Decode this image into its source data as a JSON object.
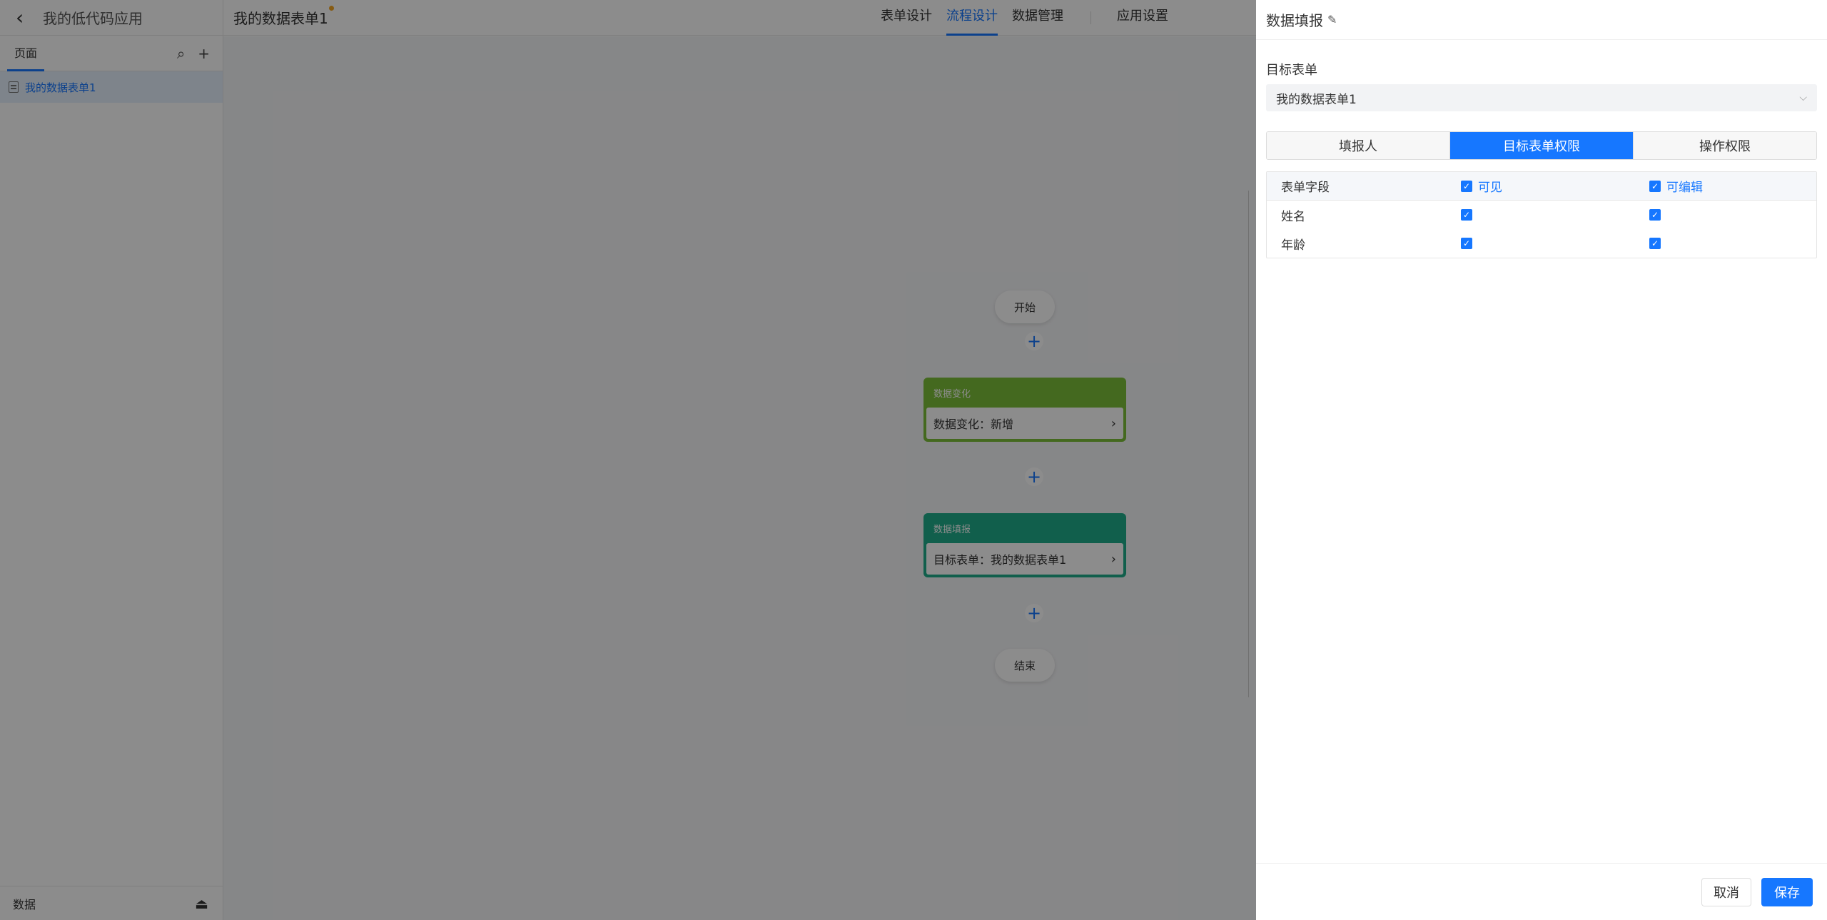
{
  "sidebar": {
    "back_icon": "chevron-left-icon",
    "app_title": "我的低代码应用",
    "tab_pages": "页面",
    "search_icon": "search-icon",
    "add_icon": "plus-icon",
    "items": [
      {
        "label": "我的数据表单1",
        "icon": "document-icon"
      }
    ],
    "footer_label": "数据",
    "footer_icon": "eject-icon"
  },
  "topbar": {
    "form_title": "我的数据表单1",
    "nav": [
      "表单设计",
      "流程设计",
      "数据管理",
      "应用设置"
    ],
    "active_nav": "流程设计"
  },
  "flow": {
    "start": "开始",
    "end": "结束",
    "nodes": [
      {
        "title": "数据变化",
        "body": "数据变化：新增",
        "color": "#7cc03a"
      },
      {
        "title": "数据填报",
        "body": "目标表单：我的数据表单1",
        "color": "#1fae8a"
      }
    ]
  },
  "drawer": {
    "title": "数据填报",
    "target_label": "目标表单",
    "target_value": "我的数据表单1",
    "tabs": [
      "填报人",
      "目标表单权限",
      "操作权限"
    ],
    "active_tab": "目标表单权限",
    "table": {
      "headers": [
        "表单字段",
        "可见",
        "可编辑"
      ],
      "rows": [
        {
          "field": "姓名",
          "visible": true,
          "editable": true
        },
        {
          "field": "年龄",
          "visible": true,
          "editable": true
        }
      ]
    },
    "cancel": "取消",
    "save": "保存"
  },
  "colors": {
    "accent": "#1677ff"
  }
}
